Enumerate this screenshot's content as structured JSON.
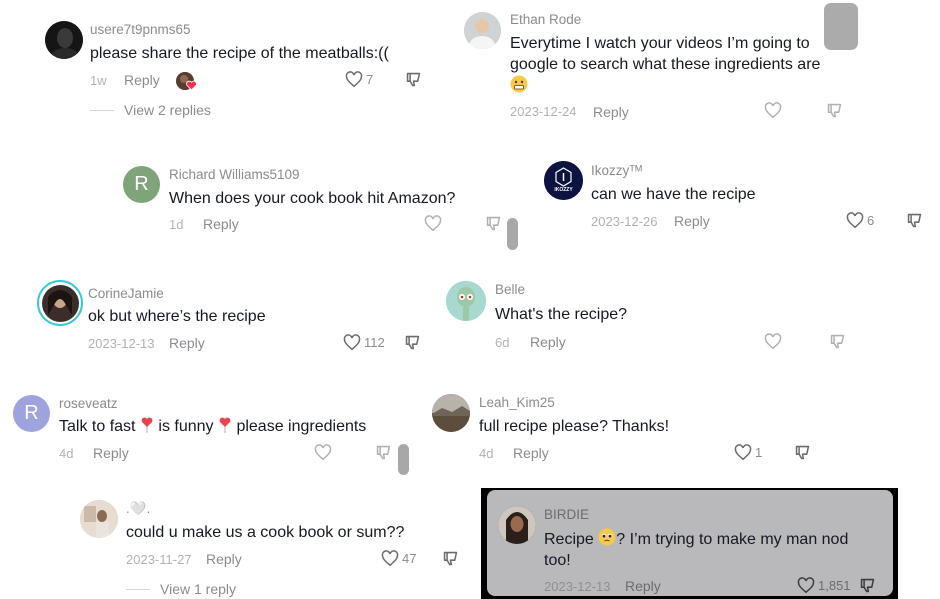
{
  "comments": [
    {
      "user": "usere7t9pnms65",
      "text": "please share the recipe of the meatballs:((",
      "date": "1w",
      "reply": "Reply",
      "likes": "7",
      "view_replies": "View 2 replies"
    },
    {
      "user": "Ethan Rode",
      "text": "Everytime I watch your videos I’m going to google to search what these ingredients are",
      "date": "2023-12-24",
      "reply": "Reply",
      "likes": ""
    },
    {
      "user": "Richard Williams5109",
      "avatar_letter": "R",
      "text": "When does your cook book hit Amazon?",
      "date": "1d",
      "reply": "Reply",
      "likes": ""
    },
    {
      "user": "Ikozzyᵀᴹ",
      "avatar_text": "IKOZZY",
      "text": "can we have the recipe",
      "date": "2023-12-26",
      "reply": "Reply",
      "likes": "6"
    },
    {
      "user": "CorineJamie",
      "text": "ok but where’s the recipe",
      "date": "2023-12-13",
      "reply": "Reply",
      "likes": "112"
    },
    {
      "user": "Belle",
      "text": "What's the recipe?",
      "date": "6d",
      "reply": "Reply",
      "likes": ""
    },
    {
      "user": "roseveatz",
      "avatar_letter": "R",
      "text_part1": "Talk to fast",
      "text_part2": "is funny",
      "text_part3": "please ingredients",
      "date": "4d",
      "reply": "Reply",
      "likes": ""
    },
    {
      "user": "Leah_Kim25",
      "text": "full recipe please? Thanks!",
      "date": "4d",
      "reply": "Reply",
      "likes": "1"
    },
    {
      "user": ".🤍.",
      "text": "could u make us a cook book or sum??",
      "date": "2023-11-27",
      "reply": "Reply",
      "likes": "47",
      "view_replies": "View 1 reply"
    },
    {
      "user": "BIRDIE",
      "text_part1": "Recipe",
      "text_part2": "? I’m trying to make my man nod too!",
      "date": "2023-12-13",
      "reply": "Reply",
      "likes": "1,851"
    }
  ],
  "colors": {
    "accent_like": "#fe2c55",
    "text": "#161823",
    "muted": "#8a8b91"
  }
}
